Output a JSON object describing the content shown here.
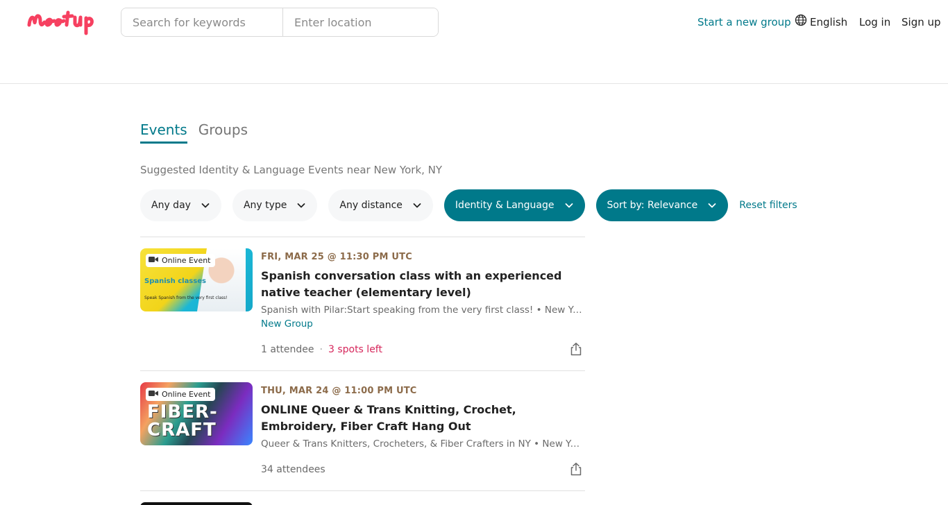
{
  "header": {
    "brand": "Meetup",
    "search_placeholder": "Search for keywords",
    "location_placeholder": "Enter location",
    "start_group": "Start a new group",
    "language": "English",
    "login": "Log in",
    "signup": "Sign up"
  },
  "tabs": [
    {
      "label": "Events",
      "active": true
    },
    {
      "label": "Groups",
      "active": false
    }
  ],
  "subtitle": "Suggested Identity & Language Events near New York, NY",
  "filters": {
    "day": "Any day",
    "type": "Any type",
    "distance": "Any distance",
    "category": "Identity & Language",
    "sort": "Sort by: Relevance",
    "reset": "Reset filters"
  },
  "events": [
    {
      "badge": "Online Event",
      "thumb_text1": "Spanish classes",
      "thumb_text2": "Speak Spanish from the very first class!",
      "date": "FRI, MAR 25 @ 11:30 PM UTC",
      "title": "Spanish conversation class with an experienced native teacher (elementary level)",
      "group": "Spanish with Pilar:Start speaking from the very first class! • New York, NY",
      "new_group": "New Group",
      "attendees": "1 attendee",
      "spots": "3 spots left"
    },
    {
      "badge": "Online Event",
      "thumb_text1": "FIBER-CRAFT",
      "date": "THU, MAR 24 @ 11:00 PM UTC",
      "title": "ONLINE Queer & Trans Knitting, Crochet, Embroidery, Fiber Craft Hang Out",
      "group": "Queer & Trans Knitters, Crocheters, & Fiber Crafters in NY • New York, NY",
      "attendees": "34 attendees"
    }
  ],
  "colors": {
    "brand": "#f64060",
    "teal": "#00798a",
    "search_button": "#f65858",
    "spots": "#d6265b",
    "date": "#8c6b4a"
  }
}
